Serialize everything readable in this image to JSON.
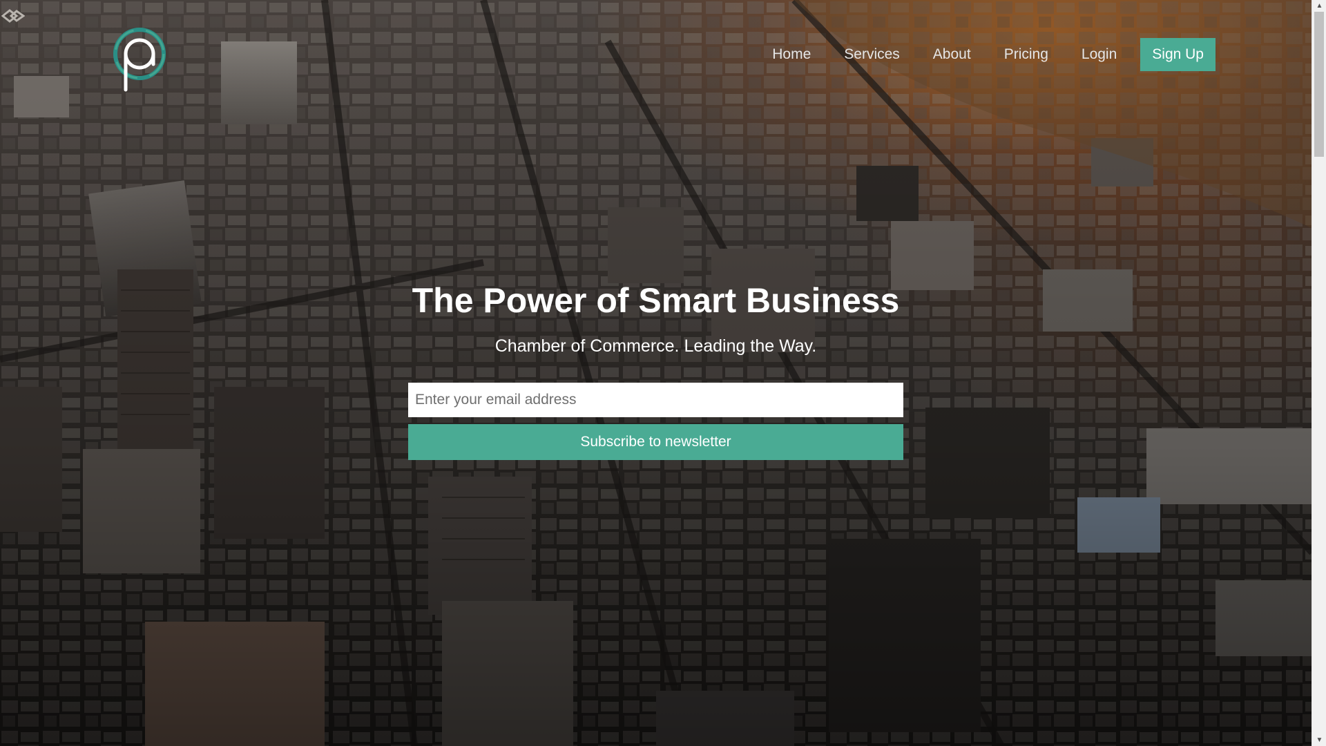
{
  "nav": {
    "items": [
      {
        "label": "Home"
      },
      {
        "label": "Services"
      },
      {
        "label": "About"
      },
      {
        "label": "Pricing"
      },
      {
        "label": "Login"
      }
    ],
    "signup_label": "Sign Up"
  },
  "hero": {
    "title": "The Power of Smart Business",
    "subtitle": "Chamber of Commerce. Leading the Way.",
    "email_placeholder": "Enter your email address",
    "subscribe_label": "Subscribe to newsletter"
  },
  "colors": {
    "accent": "#4aab94",
    "text": "#ffffff",
    "nav_text": "#e6e6e6",
    "sunset": "#d67624"
  },
  "icons": {
    "logo": "circle-p-logo-icon",
    "corner": "diamond-glyph-icon",
    "scroll_up": "arrow-up-icon",
    "scroll_down": "arrow-down-icon"
  }
}
